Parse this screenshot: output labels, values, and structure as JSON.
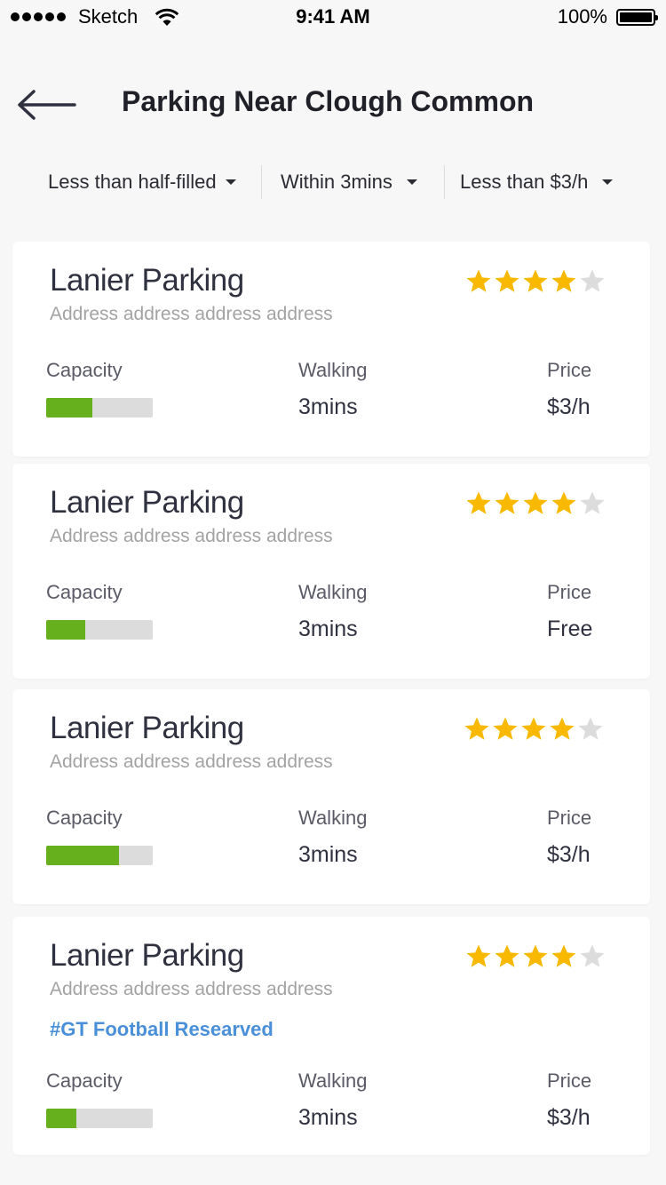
{
  "status_bar": {
    "carrier": "Sketch",
    "time": "9:41 AM",
    "battery": "100%"
  },
  "header": {
    "title": "Parking Near Clough Common",
    "back_icon": "arrow-left-icon"
  },
  "filters": [
    {
      "label": "Less than half-filled"
    },
    {
      "label": "Within 3mins"
    },
    {
      "label": "Less than $3/h"
    }
  ],
  "colors": {
    "background": "#f7f7f7",
    "card": "#ffffff",
    "capacity_fill": "#66b01d",
    "capacity_track": "#dcdcdc",
    "star_filled": "#f8b900",
    "star_empty": "#dcdcdc",
    "tag": "#4a90d9"
  },
  "cards": [
    {
      "name": "Lanier Parking",
      "address": "Address address address address",
      "rating": 4,
      "rating_max": 5,
      "tag": "",
      "capacity_label": "Capacity",
      "capacity_fraction": 0.43,
      "walking_label": "Walking",
      "walking_value": "3mins",
      "price_label": "Price",
      "price_value": "$3/h"
    },
    {
      "name": "Lanier Parking",
      "address": "Address address address address",
      "rating": 4,
      "rating_max": 5,
      "tag": "",
      "capacity_label": "Capacity",
      "capacity_fraction": 0.37,
      "walking_label": "Walking",
      "walking_value": "3mins",
      "price_label": "Price",
      "price_value": "Free"
    },
    {
      "name": "Lanier Parking",
      "address": "Address address address address",
      "rating": 4,
      "rating_max": 5,
      "tag": "",
      "capacity_label": "Capacity",
      "capacity_fraction": 0.68,
      "walking_label": "Walking",
      "walking_value": "3mins",
      "price_label": "Price",
      "price_value": "$3/h"
    },
    {
      "name": "Lanier Parking",
      "address": "Address address address address",
      "rating": 4,
      "rating_max": 5,
      "tag": "#GT Football Researved",
      "capacity_label": "Capacity",
      "capacity_fraction": 0.28,
      "walking_label": "Walking",
      "walking_value": "3mins",
      "price_label": "Price",
      "price_value": "$3/h"
    }
  ]
}
